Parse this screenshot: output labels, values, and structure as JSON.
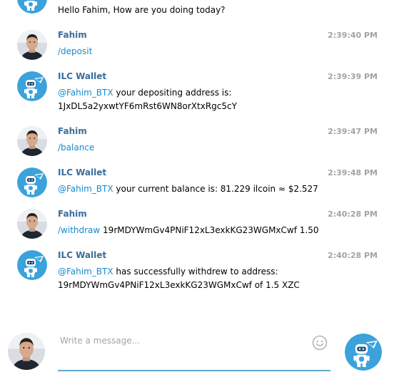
{
  "messages": [
    {
      "type": "bot",
      "text": "Hello Fahim, How are you doing today?"
    },
    {
      "type": "user",
      "sender": "Fahim",
      "time": "2:39:40 PM",
      "cmd": "/deposit",
      "rest": ""
    },
    {
      "type": "bot",
      "sender": "ILC Wallet",
      "time": "2:39:39 PM",
      "mention": "@Fahim_BTX",
      "line1": " your depositing address is:",
      "line2": "1JxDL5a2yxwtYF6mRst6WN8orXtxRgc5cY"
    },
    {
      "type": "user",
      "sender": "Fahim",
      "time": "2:39:47 PM",
      "cmd": "/balance",
      "rest": ""
    },
    {
      "type": "bot",
      "sender": "ILC Wallet",
      "time": "2:39:48 PM",
      "mention": "@Fahim_BTX",
      "line1": " your current balance is: 81.229 ilcoin ≈  $2.527",
      "line2": ""
    },
    {
      "type": "user",
      "sender": "Fahim",
      "time": "2:40:28 PM",
      "cmd": "/withdraw",
      "rest": " 19rMDYWmGv4PNiF12xL3exkKG23WGMxCwf 1.50"
    },
    {
      "type": "bot",
      "sender": "ILC Wallet",
      "time": "2:40:28 PM",
      "mention": "@Fahim_BTX",
      "line1": " has successfully withdrew to address:",
      "line2": "19rMDYWmGv4PNiF12xL3exkKG23WGMxCwf of 1.5 XZC"
    }
  ],
  "composer": {
    "placeholder": "Write a message..."
  },
  "colors": {
    "sender": "#3a6d99",
    "link": "#168acd",
    "bot_avatar": "#3ba2db",
    "time": "#a3a3a3",
    "input_line": "#5fa8d3"
  }
}
